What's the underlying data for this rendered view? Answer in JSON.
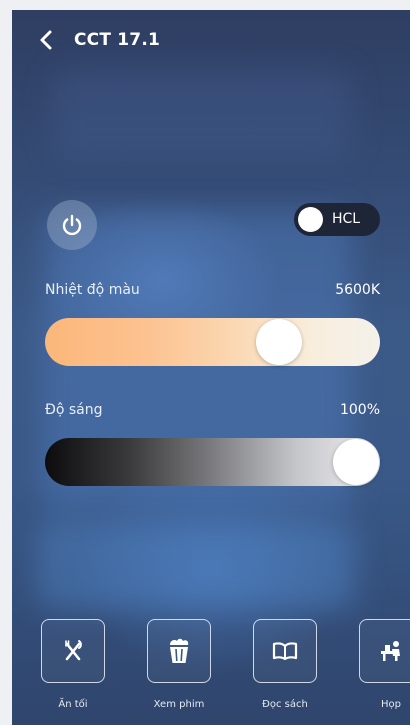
{
  "header": {
    "title": "CCT 17.1",
    "back_icon": "chevron-left-icon"
  },
  "power": {
    "icon": "power-icon"
  },
  "hcl_toggle": {
    "label": "HCL",
    "state": "off"
  },
  "color_temperature": {
    "label": "Nhiệt độ màu",
    "value_text": "5600K",
    "level": 0.73
  },
  "brightness": {
    "label": "Độ sáng",
    "value_text": "100%",
    "level": 1.0
  },
  "scenes": [
    {
      "label": "Ăn tối",
      "icon": "fork-knife-icon"
    },
    {
      "label": "Xem phim",
      "icon": "popcorn-icon"
    },
    {
      "label": "Đọc sách",
      "icon": "open-book-icon"
    },
    {
      "label": "Họp",
      "icon": "meeting-desk-icon"
    }
  ],
  "colors": {
    "background_top": "#2f3e62",
    "background_mid": "#3c5a88",
    "toggle_track": "#1e2536",
    "warm_end": "#fbb77a",
    "cool_end": "#f4f1ea",
    "text": "#ffffff"
  }
}
